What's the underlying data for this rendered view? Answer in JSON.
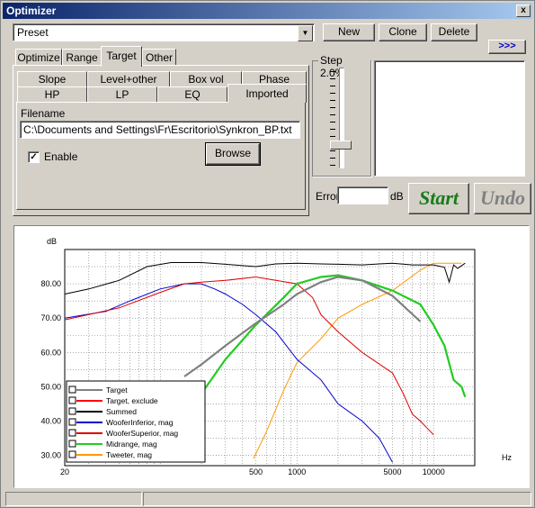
{
  "window": {
    "title": "Optimizer",
    "close_label": "x"
  },
  "preset": {
    "value": "Preset"
  },
  "toolbar": {
    "new_label": "New",
    "clone_label": "Clone",
    "delete_label": "Delete",
    "expand_label": ">>>"
  },
  "tabs": [
    "Optimize",
    "Range",
    "Target",
    "Other"
  ],
  "subtabs": {
    "row1": [
      "Slope",
      "Level+other",
      "Box vol",
      "Phase"
    ],
    "row2": [
      "HP",
      "LP",
      "EQ",
      "Imported"
    ]
  },
  "imported": {
    "filename_label": "Filename",
    "filename_value": "C:\\Documents and Settings\\Fr\\Escritorio\\Synkron_BP.txt",
    "browse_label": "Browse",
    "enable_label": "Enable",
    "enable_checked": true
  },
  "step": {
    "label": "Step 2.0%"
  },
  "error": {
    "label": "Error",
    "value": "",
    "unit": "dB"
  },
  "actions": {
    "start_label": "Start",
    "undo_label": "Undo",
    "start_color": "#1a7a1a",
    "undo_color": "#808080"
  },
  "chart_data": {
    "type": "line",
    "ylabel": "dB",
    "xlabel": "Hz",
    "xscale": "log",
    "xlim": [
      20,
      20000
    ],
    "ylim": [
      27,
      90
    ],
    "yticks": [
      {
        "value": 80,
        "label": "80.00"
      },
      {
        "value": 70,
        "label": "70.00"
      },
      {
        "value": 60,
        "label": "60.00"
      },
      {
        "value": 50,
        "label": "50.00"
      },
      {
        "value": 40,
        "label": "40.00"
      },
      {
        "value": 30,
        "label": "30.00"
      }
    ],
    "xticks": [
      {
        "value": 20,
        "label": "20"
      },
      {
        "value": 500,
        "label": "500"
      },
      {
        "value": 1000,
        "label": "1000"
      },
      {
        "value": 5000,
        "label": "5000"
      },
      {
        "value": 10000,
        "label": "10000"
      }
    ],
    "legend_position": "bottom-left",
    "series": [
      {
        "name": "Target",
        "color": "#808080",
        "points": [
          [
            150,
            53
          ],
          [
            200,
            56.5
          ],
          [
            300,
            62
          ],
          [
            500,
            68.5
          ],
          [
            800,
            74
          ],
          [
            1000,
            77
          ],
          [
            1500,
            80.5
          ],
          [
            2000,
            82
          ],
          [
            3000,
            81
          ],
          [
            5000,
            76.5
          ],
          [
            8000,
            69
          ]
        ]
      },
      {
        "name": "Target, exclude",
        "color": "#ff0000",
        "points": []
      },
      {
        "name": "Summed",
        "color": "#000000",
        "points": [
          [
            20,
            77
          ],
          [
            30,
            78.5
          ],
          [
            50,
            81
          ],
          [
            80,
            85
          ],
          [
            120,
            86.2
          ],
          [
            200,
            86.2
          ],
          [
            300,
            85.7
          ],
          [
            500,
            85
          ],
          [
            700,
            85.8
          ],
          [
            1000,
            86
          ],
          [
            1500,
            85.8
          ],
          [
            2000,
            85.7
          ],
          [
            3000,
            85.5
          ],
          [
            4000,
            85.8
          ],
          [
            5000,
            86
          ],
          [
            7000,
            85.5
          ],
          [
            10000,
            85.5
          ],
          [
            12000,
            84.8
          ],
          [
            13000,
            80.5
          ],
          [
            14000,
            85.5
          ],
          [
            15000,
            84.5
          ],
          [
            17000,
            86
          ]
        ]
      },
      {
        "name": "WooferInferior, mag",
        "color": "#0000cc",
        "points": [
          [
            20,
            70
          ],
          [
            40,
            72
          ],
          [
            60,
            75
          ],
          [
            100,
            78.5
          ],
          [
            150,
            80
          ],
          [
            200,
            80
          ],
          [
            250,
            78.5
          ],
          [
            300,
            77
          ],
          [
            400,
            74
          ],
          [
            500,
            71
          ],
          [
            700,
            66
          ],
          [
            1000,
            58
          ],
          [
            1500,
            52
          ],
          [
            2000,
            45
          ],
          [
            3000,
            40
          ],
          [
            4000,
            35
          ],
          [
            5000,
            28
          ]
        ]
      },
      {
        "name": "WooferSuperior, mag",
        "color": "#dd0000",
        "points": [
          [
            20,
            69.5
          ],
          [
            50,
            73
          ],
          [
            100,
            77.5
          ],
          [
            150,
            80
          ],
          [
            200,
            80.5
          ],
          [
            300,
            81
          ],
          [
            500,
            82
          ],
          [
            700,
            81
          ],
          [
            1000,
            80
          ],
          [
            1300,
            76
          ],
          [
            1500,
            71
          ],
          [
            2000,
            66
          ],
          [
            3000,
            60
          ],
          [
            5000,
            54
          ],
          [
            6000,
            48
          ],
          [
            7000,
            42
          ],
          [
            8000,
            40
          ],
          [
            10000,
            36
          ]
        ]
      },
      {
        "name": "Midrange, mag",
        "color": "#22cc22",
        "points": [
          [
            200,
            48
          ],
          [
            300,
            58
          ],
          [
            500,
            68
          ],
          [
            800,
            76
          ],
          [
            1000,
            80
          ],
          [
            1500,
            82
          ],
          [
            2000,
            82.5
          ],
          [
            3000,
            81
          ],
          [
            5000,
            78
          ],
          [
            8000,
            74
          ],
          [
            10000,
            68
          ],
          [
            12000,
            62
          ],
          [
            14000,
            52
          ],
          [
            16000,
            50
          ],
          [
            17000,
            47
          ]
        ]
      },
      {
        "name": "Tweeter, mag",
        "color": "#ff9900",
        "points": [
          [
            480,
            29
          ],
          [
            600,
            37
          ],
          [
            800,
            49
          ],
          [
            1000,
            57
          ],
          [
            1500,
            64
          ],
          [
            2000,
            70
          ],
          [
            3000,
            74
          ],
          [
            5000,
            78
          ],
          [
            8000,
            84
          ],
          [
            10000,
            86
          ],
          [
            12000,
            86
          ],
          [
            16000,
            86
          ]
        ]
      }
    ]
  }
}
